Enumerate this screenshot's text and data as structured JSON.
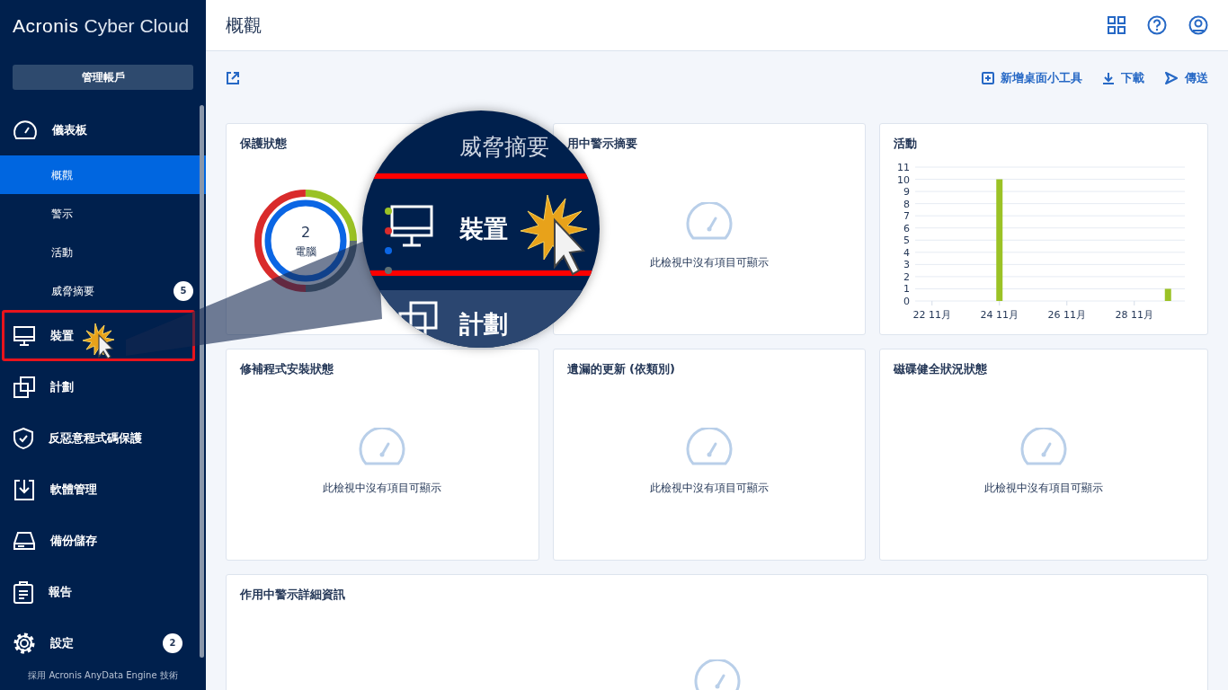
{
  "sidebar": {
    "logo_bold": "Acronis",
    "logo_light": "Cyber Cloud",
    "manage_button": "管理帳戶",
    "items": [
      {
        "label": "儀表板",
        "highlighted": false,
        "children": [
          {
            "label": "概觀",
            "selected": true
          },
          {
            "label": "警示",
            "selected": false
          },
          {
            "label": "活動",
            "selected": false
          },
          {
            "label": "威脅摘要",
            "selected": false,
            "badge": "5"
          }
        ]
      },
      {
        "label": "裝置",
        "highlighted": true
      },
      {
        "label": "計劃",
        "highlighted": false
      },
      {
        "label": "反惡意程式碼保護",
        "highlighted": false
      },
      {
        "label": "軟體管理",
        "highlighted": false
      },
      {
        "label": "備份儲存",
        "highlighted": false
      },
      {
        "label": "報告",
        "highlighted": false
      },
      {
        "label": "設定",
        "highlighted": false,
        "badge": "2"
      }
    ],
    "footer": "採用 Acronis AnyData Engine 技術"
  },
  "header": {
    "title": "概觀"
  },
  "toolbar": {
    "actions": [
      "新增桌面小工具",
      "下載",
      "傳送"
    ]
  },
  "widgets": [
    {
      "kind": "donut",
      "title": "保護狀態",
      "count": "2",
      "count_label": "電腦",
      "legend": [
        {
          "color": "#9bc225"
        },
        {
          "color": "#d92b2b"
        },
        {
          "color": "#0b66e4"
        },
        {
          "color": "#5f6f73"
        }
      ]
    },
    {
      "kind": "empty",
      "title": "用中警示摘要",
      "message": "此檢視中沒有項目可顯示"
    },
    {
      "kind": "chart",
      "title": "活動",
      "chart_data": {
        "type": "bar",
        "categories": [
          "22 11月",
          null,
          "24 11月",
          null,
          "26 11月",
          null,
          "28 11月",
          null
        ],
        "series": [
          {
            "color": "#9bc225",
            "values": [
              0,
              0,
              10,
              0,
              0,
              0,
              0,
              1
            ]
          }
        ],
        "ylim": [
          0,
          11
        ],
        "grid": true,
        "yticks": [
          0,
          1,
          2,
          3,
          4,
          5,
          6,
          7,
          8,
          9,
          10,
          11
        ]
      }
    },
    {
      "kind": "empty",
      "title": "修補程式安裝狀態",
      "message": "此檢視中沒有項目可顯示"
    },
    {
      "kind": "empty",
      "title": "遺漏的更新 (依類別)",
      "message": "此檢視中沒有項目可顯示"
    },
    {
      "kind": "empty",
      "title": "磁碟健全狀況狀態",
      "message": "此檢視中沒有項目可顯示"
    },
    {
      "kind": "wide",
      "title": "作用中警示詳細資訊"
    }
  ],
  "magnifier": {
    "items": [
      "威脅摘要",
      "裝置",
      "計劃"
    ]
  }
}
